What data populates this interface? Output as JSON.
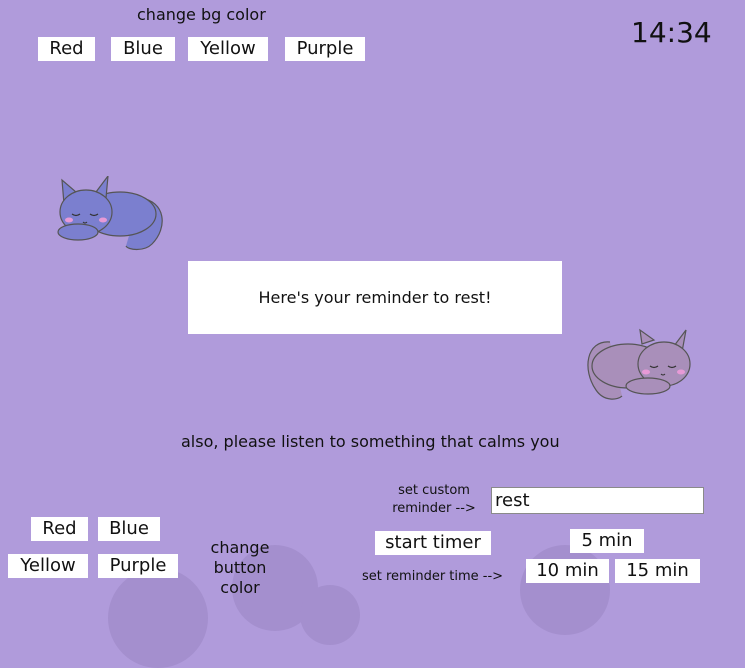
{
  "clock": {
    "time": "14:34"
  },
  "bg_color": {
    "title": "change bg color",
    "buttons": [
      "Red",
      "Blue",
      "Yellow",
      "Purple"
    ]
  },
  "reminder": {
    "message": "Here's your reminder to rest!"
  },
  "calm_text": "also, please listen to something that calms you",
  "button_color": {
    "title": "change button color",
    "buttons": [
      "Red",
      "Blue",
      "Yellow",
      "Purple"
    ]
  },
  "custom_reminder": {
    "label": "set custom reminder -->",
    "value": "rest"
  },
  "timer": {
    "start_label": "start timer",
    "set_time_label": "set reminder time -->",
    "options": [
      "5 min",
      "10 min",
      "15 min"
    ]
  },
  "colors": {
    "background": "#b09bdb",
    "button_bg": "#ffffff",
    "blue_cat": "#7b7fcf",
    "pink_cat": "#a98fba"
  },
  "icons": [
    "sleeping-blue-cat-icon",
    "sleeping-pink-cat-icon"
  ]
}
